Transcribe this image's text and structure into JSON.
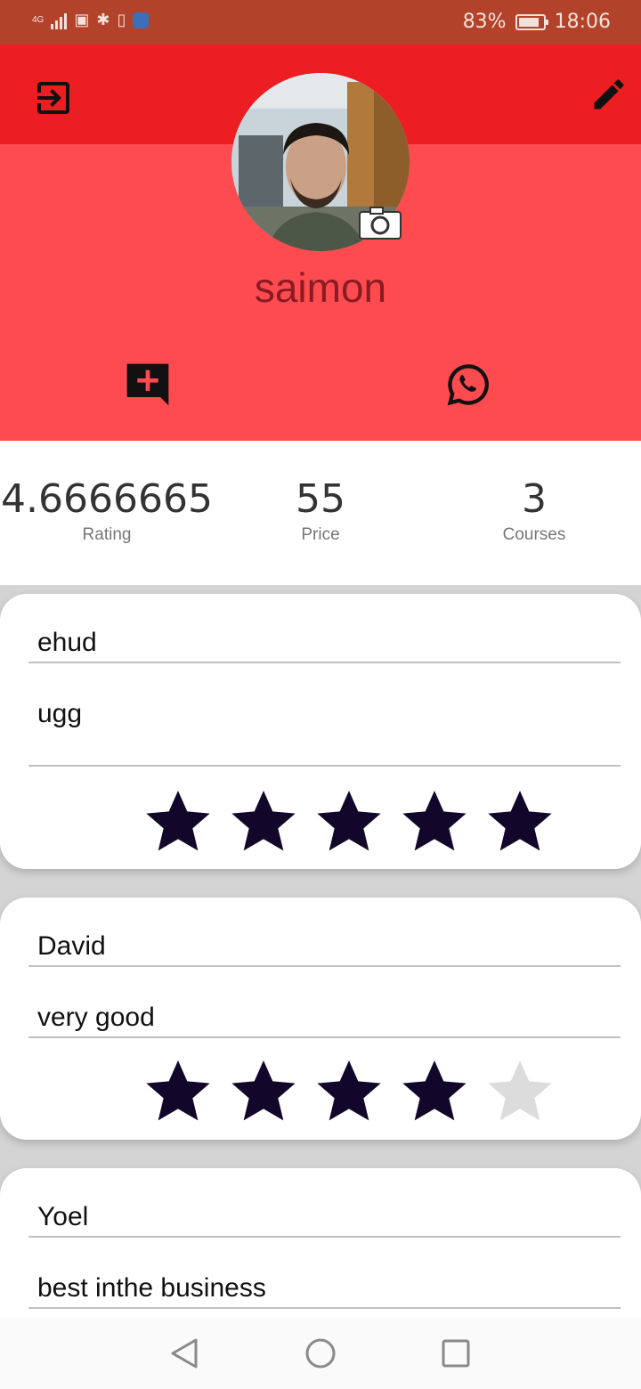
{
  "status_bar": {
    "network": "4G",
    "battery_percent": "83%",
    "battery_level": 0.83,
    "time": "18:06",
    "icons": [
      "signal-icon",
      "nfc-icon",
      "bluetooth-icon",
      "vibrate-icon",
      "app-notification-icon",
      "battery-icon"
    ]
  },
  "header": {
    "logout_icon": "logout-icon",
    "edit_icon": "pencil-icon"
  },
  "profile": {
    "username": "saimon",
    "camera_icon": "camera-icon",
    "actions": [
      "add-comment-icon",
      "whatsapp-icon"
    ]
  },
  "stats": [
    {
      "value": "4.6666665",
      "label": "Rating"
    },
    {
      "value": "55",
      "label": "Price"
    },
    {
      "value": "3",
      "label": "Courses"
    }
  ],
  "reviews": [
    {
      "name": "ehud",
      "comment": "ugg",
      "rating": 5
    },
    {
      "name": "David",
      "comment": "very good",
      "rating": 4
    },
    {
      "name": "Yoel",
      "comment": "best inthe business",
      "rating": null
    }
  ],
  "colors": {
    "status_bar": "#b2432a",
    "app_bar": "#ec1e22",
    "hero": "#fd4b50",
    "star_filled": "#12072a",
    "star_empty": "#dcdcdc",
    "username": "#8b1b22"
  }
}
